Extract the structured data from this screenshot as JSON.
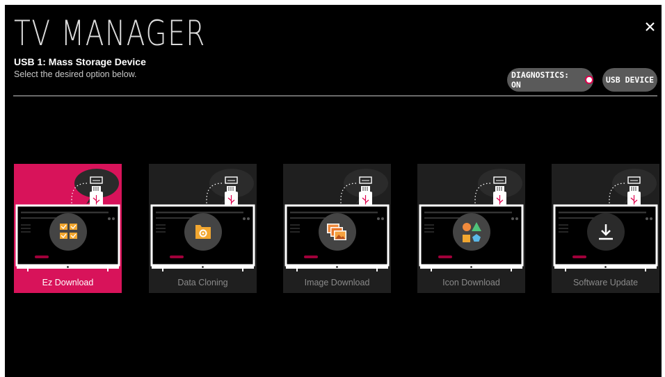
{
  "header": {
    "title": "TV MANAGER",
    "close_icon": "close-icon",
    "device_name": "USB 1: Mass Storage Device",
    "instruction": "Select the desired option below."
  },
  "toolbar": {
    "diagnostics_label": "DIAGNOSTICS: ON",
    "diagnostics_on": true,
    "usb_device_label": "USB DEVICE"
  },
  "options": [
    {
      "label": "Ez Download",
      "icon": "checklist-icon",
      "selected": true
    },
    {
      "label": "Data Cloning",
      "icon": "folder-gear-icon",
      "selected": false
    },
    {
      "label": "Image Download",
      "icon": "image-stack-icon",
      "selected": false
    },
    {
      "label": "Icon Download",
      "icon": "shapes-icon",
      "selected": false
    },
    {
      "label": "Software Update",
      "icon": "download-arrow-icon",
      "selected": false
    }
  ],
  "colors": {
    "accent": "#d8135a",
    "usb_red": "#e0004d",
    "background": "#000000",
    "card_idle": "#1f1f1f",
    "pill": "#5a5a5a"
  }
}
